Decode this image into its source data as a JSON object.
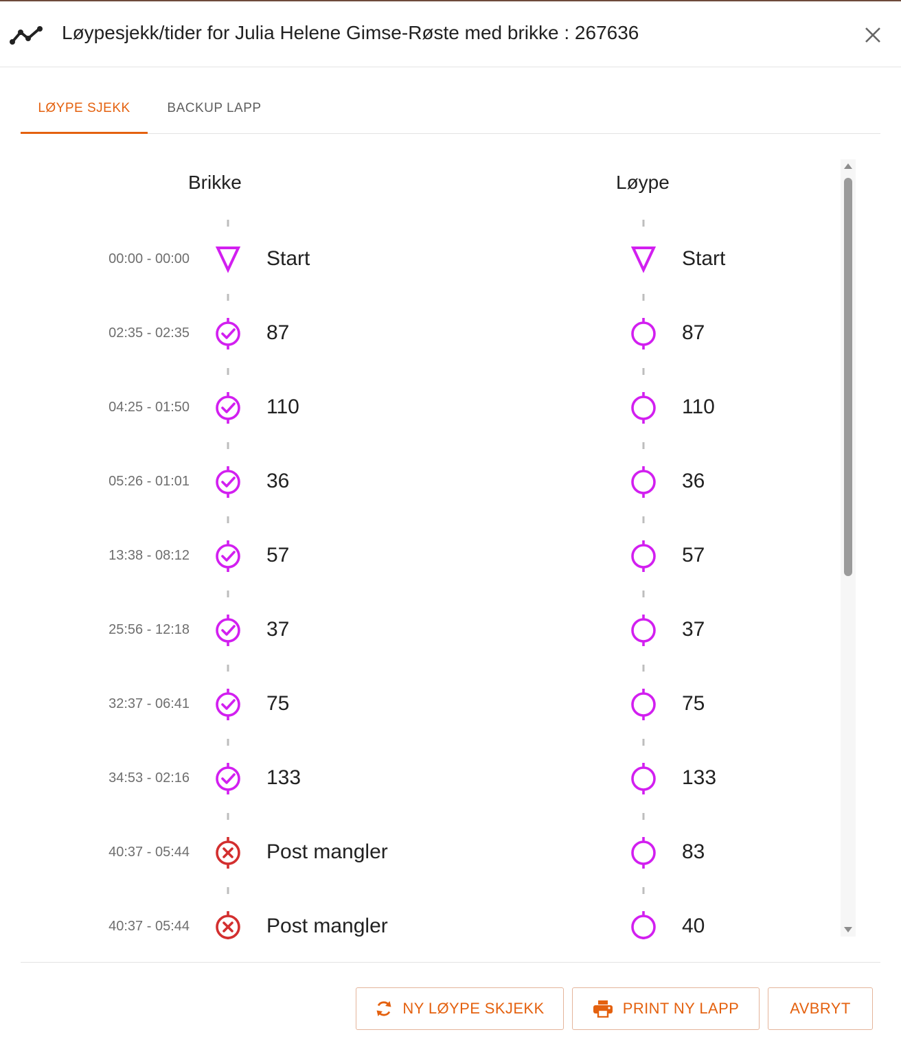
{
  "dialog": {
    "title": "Løypesjekk/tider for Julia Helene Gimse-Røste med brikke : 267636",
    "icon": "route-icon",
    "close_icon": "close-icon"
  },
  "tabs": [
    {
      "label": "LØYPE SJEKK",
      "active": true
    },
    {
      "label": "BACKUP LAPP",
      "active": false
    }
  ],
  "columns": {
    "brikke": "Brikke",
    "loype": "Løype"
  },
  "rows": [
    {
      "time": "00:00 - 00:00",
      "brikke_icon": "start-triangle-icon",
      "brikke_label": "Start",
      "loype_icon": "start-triangle-icon",
      "loype_label": "Start"
    },
    {
      "time": "02:35 - 02:35",
      "brikke_icon": "control-check-icon",
      "brikke_label": "87",
      "loype_icon": "control-circle-icon",
      "loype_label": "87"
    },
    {
      "time": "04:25 - 01:50",
      "brikke_icon": "control-check-icon",
      "brikke_label": "110",
      "loype_icon": "control-circle-icon",
      "loype_label": "110"
    },
    {
      "time": "05:26 - 01:01",
      "brikke_icon": "control-check-icon",
      "brikke_label": "36",
      "loype_icon": "control-circle-icon",
      "loype_label": "36"
    },
    {
      "time": "13:38 - 08:12",
      "brikke_icon": "control-check-icon",
      "brikke_label": "57",
      "loype_icon": "control-circle-icon",
      "loype_label": "57"
    },
    {
      "time": "25:56 - 12:18",
      "brikke_icon": "control-check-icon",
      "brikke_label": "37",
      "loype_icon": "control-circle-icon",
      "loype_label": "37"
    },
    {
      "time": "32:37 - 06:41",
      "brikke_icon": "control-check-icon",
      "brikke_label": "75",
      "loype_icon": "control-circle-icon",
      "loype_label": "75"
    },
    {
      "time": "34:53 - 02:16",
      "brikke_icon": "control-check-icon",
      "brikke_label": "133",
      "loype_icon": "control-circle-icon",
      "loype_label": "133"
    },
    {
      "time": "40:37 - 05:44",
      "brikke_icon": "missing-x-icon",
      "brikke_label": "Post mangler",
      "loype_icon": "control-circle-icon",
      "loype_label": "83"
    },
    {
      "time": "40:37 - 05:44",
      "brikke_icon": "missing-x-icon",
      "brikke_label": "Post mangler",
      "loype_icon": "control-circle-icon",
      "loype_label": "40"
    }
  ],
  "buttons": [
    {
      "label": "NY LØYPE SKJEKK",
      "icon": "refresh-icon"
    },
    {
      "label": "PRINT NY LAPP",
      "icon": "printer-icon"
    },
    {
      "label": "AVBRYT"
    }
  ],
  "colors": {
    "accent": "#e4610f",
    "control": "#d21ff0",
    "missing": "#d32f2f",
    "time_text": "#6e6e6e"
  }
}
